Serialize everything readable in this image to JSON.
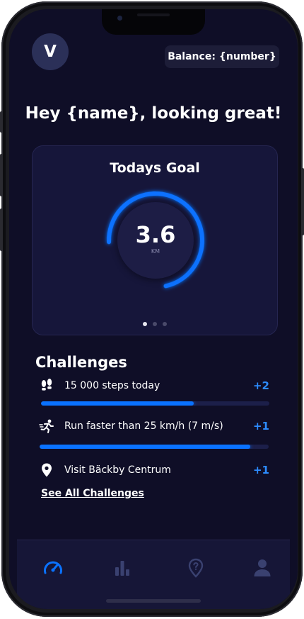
{
  "header": {
    "avatar_initial": "V",
    "balance_label": "Balance:",
    "balance_value": "{number}"
  },
  "greeting": "Hey {name}, looking great!",
  "goal_card": {
    "title": "Todays Goal",
    "value": "3.6",
    "unit": "KM",
    "progress": 0.72,
    "page_count": 3,
    "active_page": 1
  },
  "challenges": {
    "title": "Challenges",
    "items": [
      {
        "icon": "footsteps-icon",
        "label": "15 000 steps today",
        "points": "+2",
        "progress": 0.67
      },
      {
        "icon": "running-icon",
        "label": "Run faster than 25 km/h (7 m/s)",
        "points": "+1",
        "progress": 0.92
      },
      {
        "icon": "location-pin-icon",
        "label": "Visit Bäckby Centrum",
        "points": "+1",
        "progress": null
      }
    ],
    "see_all": "See All Challenges"
  },
  "tabs": [
    {
      "icon": "speedometer-icon",
      "active": true
    },
    {
      "icon": "bar-chart-icon",
      "active": false
    },
    {
      "icon": "map-pin-question-icon",
      "active": false
    },
    {
      "icon": "user-icon",
      "active": false
    }
  ],
  "colors": {
    "background": "#0f0e27",
    "card": "#16163a",
    "accent": "#0a72ff",
    "inactive_icon": "#3a4170",
    "text": "#ffffff"
  }
}
